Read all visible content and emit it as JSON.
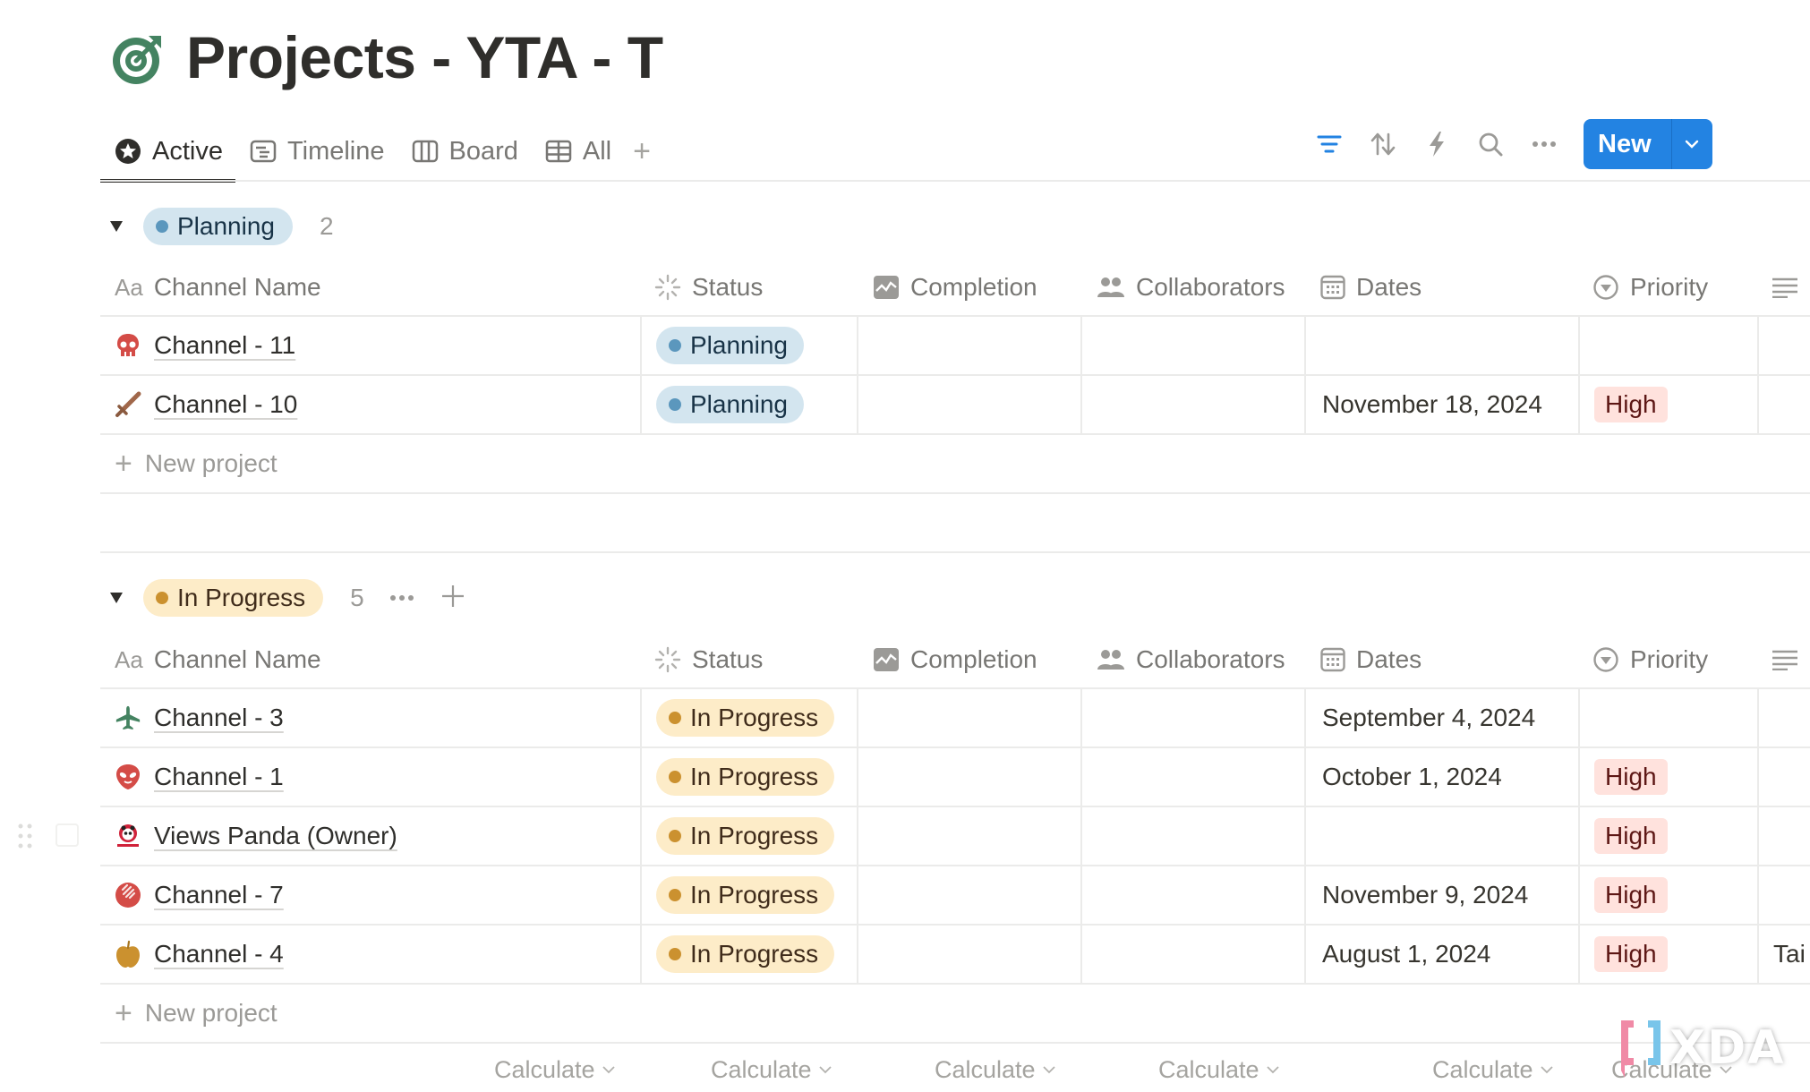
{
  "page": {
    "title": "Projects - YTA - T",
    "icon": "target-icon",
    "icon_color": "#448361"
  },
  "tabs": [
    {
      "label": "Active",
      "icon": "star-circle-icon",
      "active": true
    },
    {
      "label": "Timeline",
      "icon": "timeline-icon",
      "active": false
    },
    {
      "label": "Board",
      "icon": "board-icon",
      "active": false
    },
    {
      "label": "All",
      "icon": "table-icon",
      "active": false
    }
  ],
  "tabs_add": "+",
  "toolbar": {
    "icons": [
      "filter-icon",
      "sort-icon",
      "automation-icon",
      "search-icon",
      "more-icon"
    ],
    "new_label": "New",
    "accent": "#2383e2"
  },
  "columns": [
    {
      "label": "Channel Name",
      "icon": "title-icon",
      "icon_text": "Aa"
    },
    {
      "label": "Status",
      "icon": "status-icon"
    },
    {
      "label": "Completion",
      "icon": "chart-icon"
    },
    {
      "label": "Collaborators",
      "icon": "people-icon"
    },
    {
      "label": "Dates",
      "icon": "calendar-icon"
    },
    {
      "label": "Priority",
      "icon": "select-icon"
    },
    {
      "label": "",
      "icon": "text-icon"
    }
  ],
  "groups": [
    {
      "name": "Planning",
      "count": "2",
      "color": "#5b97bd",
      "rows": [
        {
          "icon": "skull-icon",
          "name": "Channel - 11",
          "status": "Planning",
          "dates": "",
          "priority": "",
          "extra": ""
        },
        {
          "icon": "sword-icon",
          "name": "Channel - 10",
          "status": "Planning",
          "dates": "November 18, 2024",
          "priority": "High",
          "extra": ""
        }
      ],
      "new_label": "New project"
    },
    {
      "name": "In Progress",
      "count": "5",
      "color": "#cb912f",
      "rows": [
        {
          "icon": "airplane-icon",
          "name": "Channel - 3",
          "status": "In Progress",
          "dates": "September 4, 2024",
          "priority": "",
          "extra": ""
        },
        {
          "icon": "alien-icon",
          "name": "Channel - 1",
          "status": "In Progress",
          "dates": "October 1, 2024",
          "priority": "High",
          "extra": ""
        },
        {
          "icon": "panda-logo-icon",
          "name": "Views Panda (Owner)",
          "status": "In Progress",
          "dates": "",
          "priority": "High",
          "extra": ""
        },
        {
          "icon": "ball-icon",
          "name": "Channel - 7",
          "status": "In Progress",
          "dates": "November 9, 2024",
          "priority": "High",
          "extra": ""
        },
        {
          "icon": "apple-icon",
          "name": "Channel - 4",
          "status": "In Progress",
          "dates": "August 1, 2024",
          "priority": "High",
          "extra": "Tai"
        }
      ],
      "new_label": "New project"
    }
  ],
  "calculate_label": "Calculate",
  "watermark": "XDA"
}
